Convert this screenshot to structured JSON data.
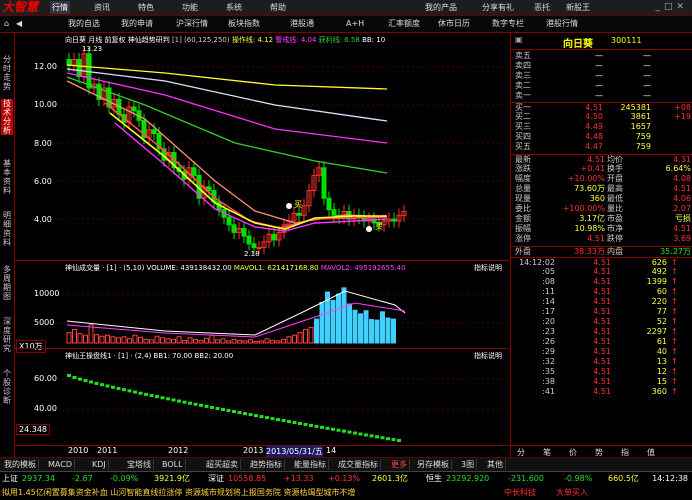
{
  "menubar": {
    "logo": "大智慧",
    "items": [
      "行情",
      "资讯",
      "特色",
      "功能",
      "系统",
      "帮助"
    ],
    "right": [
      "我的产品",
      "分享有礼",
      "恶托",
      "新股王"
    ]
  },
  "subbar": {
    "tabs": [
      "我的自选",
      "我的申请",
      "沪深行情",
      "板块指数",
      "港股通",
      "A+H",
      "汇率额度",
      "休市日历",
      "数字专栏",
      "港股行情"
    ]
  },
  "sidebar": [
    "分时走势",
    "技术分析",
    "基本资料",
    "明细资料",
    "多周期图",
    "深度研究",
    "个股诊断"
  ],
  "kline": {
    "header": {
      "stock": "向日葵",
      "period": "月线",
      "adjust": "前复权",
      "indicator": "神仙趋势研判",
      "params": "[1] (60,125,250)",
      "op_line": "操作线: 4.12",
      "warn_line": "警戒线: 4.04",
      "profit_line": "获利线: 6.58",
      "bb": "BB: 10"
    },
    "y_ticks": [
      "12.00",
      "10.00",
      "8.00",
      "6.00",
      "4.00"
    ],
    "high_label": "13.23",
    "low_label": "2.18",
    "buy_labels": [
      "买",
      "买"
    ],
    "colors": {
      "up": "#ff3030",
      "down": "#00e000",
      "ma1": "#ffff30",
      "ma2": "#ff30ff",
      "ma3": "#ff5050",
      "ma4": "#30d030",
      "ma5": "#e0e0ff",
      "ma6": "#ff9070"
    }
  },
  "volume": {
    "header": "神仙成交量 · [1] · (5,10)  VOLUME: 439138432.00",
    "mavol1": "MAVOL1: 621417168.80",
    "mavol2": "MAVOL2: 495192655.40",
    "explain": "指标说明",
    "y_ticks": [
      "10000",
      "5000"
    ],
    "unit": "X10万"
  },
  "macd": {
    "header": "神仙王操盘线1 · [1] · (2,4)  BB1: 70.00",
    "bb2": "BB2: 20.00",
    "explain": "指标说明",
    "y_ticks": [
      "60.00",
      "40.00"
    ],
    "value": "24.348"
  },
  "xaxis": {
    "labels": [
      "2010",
      "2011",
      "2012",
      "2013",
      "2013/05/31/五",
      "14"
    ]
  },
  "quote": {
    "name": "向日葵",
    "code": "300111",
    "asks": [
      {
        "label": "卖五",
        "price": "—",
        "vol": "—"
      },
      {
        "label": "卖四",
        "price": "—",
        "vol": "—"
      },
      {
        "label": "卖三",
        "price": "—",
        "vol": "—"
      },
      {
        "label": "卖二",
        "price": "—",
        "vol": "—"
      },
      {
        "label": "卖一",
        "price": "—",
        "vol": "—"
      }
    ],
    "bids": [
      {
        "label": "买一",
        "price": "4.51",
        "vol": "245381",
        "chg": "+08"
      },
      {
        "label": "买二",
        "price": "4.50",
        "vol": "3861",
        "chg": "+19"
      },
      {
        "label": "买三",
        "price": "4.49",
        "vol": "1657",
        "chg": ""
      },
      {
        "label": "买四",
        "price": "4.48",
        "vol": "759",
        "chg": ""
      },
      {
        "label": "买五",
        "price": "4.47",
        "vol": "759",
        "chg": ""
      }
    ],
    "stats": [
      {
        "l1": "最新",
        "v1": "4.51",
        "l2": "均价",
        "v2": "4.31"
      },
      {
        "l1": "涨跌",
        "v1": "+0.41",
        "l2": "换手",
        "v2": "6.64%"
      },
      {
        "l1": "幅度",
        "v1": "+10.00%",
        "l2": "开盘",
        "v2": "4.08"
      },
      {
        "l1": "总量",
        "v1": "73.60万",
        "l2": "最高",
        "v2": "4.51"
      },
      {
        "l1": "现量",
        "v1": "360",
        "l2": "最低",
        "v2": "4.06"
      },
      {
        "l1": "委比",
        "v1": "+100.00%",
        "l2": "量比",
        "v2": "2.07"
      },
      {
        "l1": "金额",
        "v1": "3.17亿",
        "l2": "市盈",
        "v2": "亏损"
      },
      {
        "l1": "振幅",
        "v1": "10.98%",
        "l2": "市净",
        "v2": "4.51"
      },
      {
        "l1": "涨停",
        "v1": "4.51",
        "l2": "跌停",
        "v2": "3.69"
      }
    ],
    "outer": {
      "label": "外盘",
      "value": "38.33万",
      "label2": "内盘",
      "value2": "35.27万"
    },
    "ticks": [
      {
        "t": "14:12:02",
        "p": "4.51",
        "v": "626"
      },
      {
        "t": ":05",
        "p": "4.51",
        "v": "492"
      },
      {
        "t": ":08",
        "p": "4.51",
        "v": "1399"
      },
      {
        "t": ":11",
        "p": "4.51",
        "v": "60"
      },
      {
        "t": ":14",
        "p": "4.51",
        "v": "220"
      },
      {
        "t": ":17",
        "p": "4.51",
        "v": "77"
      },
      {
        "t": ":20",
        "p": "4.51",
        "v": "52"
      },
      {
        "t": ":23",
        "p": "4.51",
        "v": "2297"
      },
      {
        "t": ":26",
        "p": "4.51",
        "v": "61"
      },
      {
        "t": ":29",
        "p": "4.51",
        "v": "40"
      },
      {
        "t": ":32",
        "p": "4.51",
        "v": "13"
      },
      {
        "t": ":35",
        "p": "4.51",
        "v": "12"
      },
      {
        "t": ":38",
        "p": "4.51",
        "v": "15"
      },
      {
        "t": ":41",
        "p": "4.51",
        "v": "360"
      }
    ],
    "bottom_tabs": [
      "分",
      "笔",
      "价",
      "势",
      "指",
      "值"
    ]
  },
  "bottombar": {
    "tabs": [
      "我的模板",
      "MACD",
      "KDJ",
      "宝塔线",
      "BOLL",
      "超买超卖",
      "趋势指标",
      "能量指标",
      "成交量指标",
      "更多",
      "另存模板",
      "3图",
      "其他"
    ]
  },
  "ticker": [
    {
      "name": "上证",
      "val": "2937.34",
      "chg": "-2.67",
      "pct": "-0.09%",
      "amt": "3921.9亿"
    },
    {
      "name": "深证",
      "val": "10558.85",
      "chg": "+13.33",
      "pct": "+0.13%",
      "amt": "2601.3亿"
    },
    {
      "name": "恒生",
      "val": "23292.920",
      "chg": "-231.600",
      "pct": "-0.98%",
      "amt": "660.5亿"
    }
  ],
  "ticker_time": "14:12:38",
  "marquee": "拟用1.45亿闲置募集资金补血 山河智能直线拉涨停 资源城市规划将上报国务院 资源枯竭型城市不增",
  "marquee_right": [
    "中长科技",
    "大单买入"
  ]
}
